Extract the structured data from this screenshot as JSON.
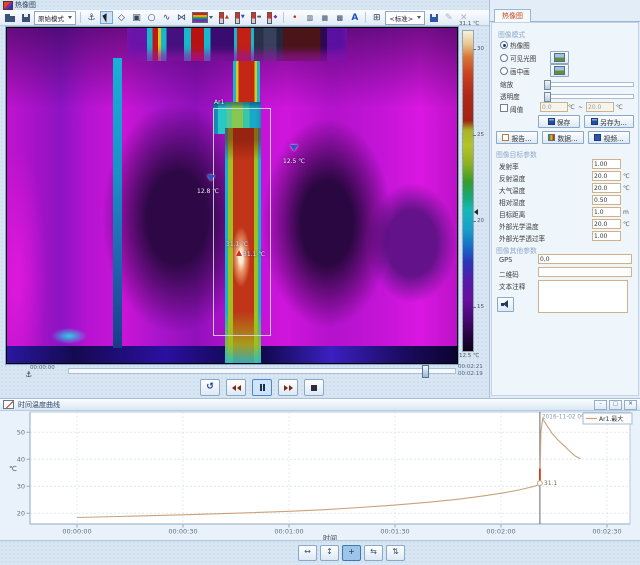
{
  "window": {
    "title": "热像图"
  },
  "toolbar": {
    "mode_dropdown": "原始模式",
    "preset_dropdown": "<标准>",
    "items": [
      {
        "name": "open-file-button",
        "kind": "folder"
      },
      {
        "name": "save-file-button",
        "kind": "disk"
      },
      {
        "name": "display-mode-dropdown",
        "kind": "dropdown",
        "bind": "mode_dropdown"
      },
      {
        "name": "toolbar-separator",
        "kind": "sep"
      },
      {
        "name": "anchor-tool-button",
        "kind": "glyph",
        "glyph": "⚓"
      },
      {
        "name": "select-tool-button",
        "kind": "cursor",
        "active": true
      },
      {
        "name": "spot-tool-button",
        "kind": "glyph",
        "glyph": "◇"
      },
      {
        "name": "area-tool-button",
        "kind": "glyph",
        "glyph": "▣"
      },
      {
        "name": "ellipse-tool-button",
        "kind": "glyph",
        "glyph": "○"
      },
      {
        "name": "line-tool-button",
        "kind": "glyph",
        "glyph": "∿"
      },
      {
        "name": "polygon-tool-button",
        "kind": "glyph",
        "glyph": "⋈"
      },
      {
        "name": "palette-dropdown",
        "kind": "palette"
      },
      {
        "name": "isotherm-high-button",
        "kind": "thermo",
        "mark": "▲",
        "mark_color": "#c03018"
      },
      {
        "name": "isotherm-low-button",
        "kind": "thermo",
        "mark": "▼",
        "mark_color": "#2050c8"
      },
      {
        "name": "isotherm-interval-button",
        "kind": "thermo",
        "mark": "▬",
        "mark_color": "#555"
      },
      {
        "name": "isotherm-invert-button",
        "kind": "thermo",
        "mark": "◆",
        "mark_color": "#8828a8"
      },
      {
        "name": "toolbar-separator",
        "kind": "sep"
      },
      {
        "name": "spot-list-button",
        "kind": "glyph",
        "glyph": "•",
        "color": "#c03018"
      },
      {
        "name": "profile-chart-button",
        "kind": "glyph",
        "glyph": "▥",
        "small": true
      },
      {
        "name": "histogram-button",
        "kind": "glyph",
        "glyph": "▦",
        "small": true
      },
      {
        "name": "matrix-button",
        "kind": "glyph",
        "glyph": "▩",
        "small": true
      },
      {
        "name": "text-annotation-button",
        "kind": "glyph",
        "glyph": "A",
        "color": "#2050c0",
        "bold": true
      },
      {
        "name": "toolbar-separator",
        "kind": "sep"
      },
      {
        "name": "grid-overlay-button",
        "kind": "glyph",
        "glyph": "⊞"
      },
      {
        "name": "preset-dropdown",
        "kind": "dropdown",
        "bind": "preset_dropdown"
      },
      {
        "name": "save-preset-button",
        "kind": "disk2"
      },
      {
        "name": "edit-preset-button",
        "kind": "glyph",
        "glyph": "✎",
        "disabled": true
      },
      {
        "name": "delete-preset-button",
        "kind": "glyph",
        "glyph": "✕",
        "disabled": true
      }
    ]
  },
  "viewer": {
    "annotations": {
      "area": "Ar1",
      "spot_left": "12.8 ℃",
      "spot_right": "12.5 ℃",
      "area_max": "31.1 ℃",
      "max_spot": "31.1 ℃"
    },
    "colorbar": {
      "max_label": "31.1 ℃",
      "min_label": "12.5 ℃",
      "ticks": [
        30,
        25,
        20,
        15
      ],
      "range_max": 31.1,
      "range_min": 12.5
    },
    "timeline": {
      "start": "00:00:00",
      "current": "00:02:21",
      "total": "00:02:19"
    },
    "playback": [
      {
        "name": "replay-button",
        "kind": "restart"
      },
      {
        "name": "step-back-button",
        "kind": "prev"
      },
      {
        "name": "pause-button",
        "kind": "pause",
        "active": true
      },
      {
        "name": "step-forward-button",
        "kind": "next"
      },
      {
        "name": "stop-button",
        "kind": "stop"
      }
    ]
  },
  "right_panel": {
    "tab": "热像图",
    "image_mode": {
      "header": "图像模式",
      "radio_thermal": "热像图",
      "radio_visible": "可见光图",
      "radio_pip": "画中画",
      "zoom": "缩放",
      "opacity": "透明度",
      "threshold": "阈值",
      "threshold_min": "0.0",
      "threshold_max": "20.0",
      "deg": "℃",
      "tilde": "~"
    },
    "buttons": {
      "save": "保存",
      "save_as": "另存为...",
      "report": "报告...",
      "data": "数据...",
      "video": "视频..."
    },
    "target_params": {
      "header": "图像目标参数",
      "rows": [
        {
          "label": "发射率",
          "value": "1.00",
          "unit": ""
        },
        {
          "label": "反射温度",
          "value": "20.0",
          "unit": "℃"
        },
        {
          "label": "大气温度",
          "value": "20.0",
          "unit": "℃"
        },
        {
          "label": "相对湿度",
          "value": "0.50",
          "unit": ""
        },
        {
          "label": "目标距离",
          "value": "1.0",
          "unit": "m"
        },
        {
          "label": "外部光学温度",
          "value": "20.0",
          "unit": "℃"
        },
        {
          "label": "外部光学透过率",
          "value": "1.00",
          "unit": ""
        }
      ]
    },
    "other_params": {
      "header": "图像其他参数",
      "gps_label": "GPS",
      "gps_value": "0,0",
      "qr_label": "二维码",
      "qr_value": "",
      "note_label": "文本注释",
      "note_value": ""
    }
  },
  "chart": {
    "title": "时间温度曲线"
  },
  "chart_data": {
    "type": "line",
    "title": "时间温度曲线",
    "xlabel": "时间",
    "ylabel": "℃",
    "x_ticks": [
      "00:00:00",
      "00:00:30",
      "00:01:00",
      "00:01:30",
      "00:02:00",
      "00:02:30"
    ],
    "x_tick_seconds": [
      0,
      30,
      60,
      90,
      120,
      150
    ],
    "y_ticks": [
      20,
      30,
      40,
      50
    ],
    "ylim": [
      16,
      57.5
    ],
    "legend": "Ar1.最大",
    "series": [
      {
        "name": "Ar1.最大",
        "color": "#c9a27a",
        "points": [
          [
            0,
            18.4
          ],
          [
            15,
            18.9
          ],
          [
            30,
            19.4
          ],
          [
            45,
            20.0
          ],
          [
            60,
            20.7
          ],
          [
            70,
            21.3
          ],
          [
            80,
            22.1
          ],
          [
            90,
            23.0
          ],
          [
            100,
            24.1
          ],
          [
            108,
            25.2
          ],
          [
            115,
            26.4
          ],
          [
            121,
            27.6
          ],
          [
            125,
            28.6
          ],
          [
            128,
            29.5
          ],
          [
            130,
            30.2
          ],
          [
            131,
            31.1
          ],
          [
            131.3,
            50.0
          ],
          [
            131.8,
            55.0
          ],
          [
            133,
            52.5
          ],
          [
            134.5,
            49.5
          ],
          [
            136,
            47.3
          ],
          [
            138,
            44.8
          ],
          [
            139.5,
            42.9
          ],
          [
            141,
            41.2
          ],
          [
            142.5,
            40.2
          ]
        ]
      }
    ],
    "cursor": {
      "t": 131,
      "value": 31.1,
      "label": "31.1",
      "timestamp": "2016-11-02 09:59:39",
      "red_segment_top": 36.5
    }
  },
  "bottom_toolbar": [
    {
      "name": "chart-zoom-horizontal-button",
      "glyph": "↔"
    },
    {
      "name": "chart-zoom-vertical-button",
      "glyph": "↕"
    },
    {
      "name": "chart-zoom-fit-button",
      "glyph": "+",
      "active": true
    },
    {
      "name": "chart-scroll-horizontal-button",
      "glyph": "⇆"
    },
    {
      "name": "chart-scroll-vertical-button",
      "glyph": "⇅"
    }
  ]
}
